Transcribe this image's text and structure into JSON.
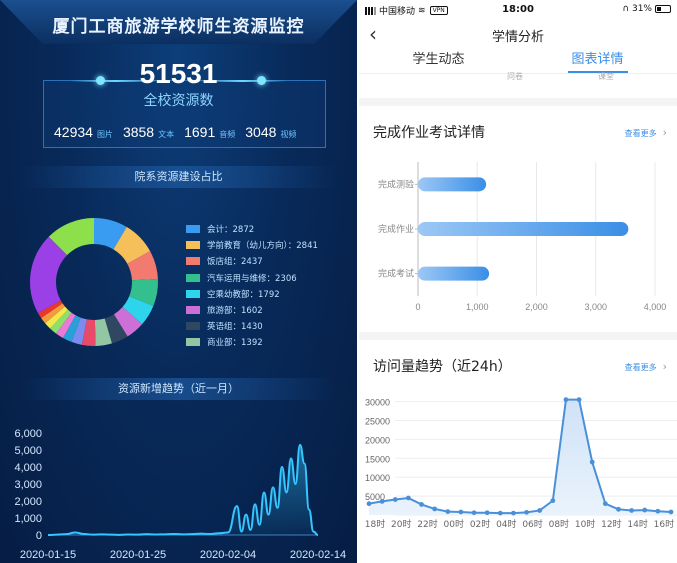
{
  "dashboard": {
    "title": "厦门工商旅游学校师生资源监控",
    "total": "51531",
    "total_label": "全校资源数",
    "stats": [
      {
        "value": "42934",
        "unit": "图片"
      },
      {
        "value": "3858",
        "unit": "文本"
      },
      {
        "value": "1691",
        "unit": "音频"
      },
      {
        "value": "3048",
        "unit": "视频"
      }
    ],
    "donut_section_title": "院系资源建设占比",
    "trend_section_title": "资源新增趋势（近一月）"
  },
  "chart_data": [
    {
      "type": "pie",
      "variant": "donut",
      "legend_position": "right",
      "legend_shows_first": 8,
      "slices": [
        {
          "label": "会计",
          "value": 2872,
          "color": "#3a9cf0"
        },
        {
          "label": "学前教育（幼儿方向）",
          "value": 2841,
          "color": "#f5c05a"
        },
        {
          "label": "饭店组",
          "value": 2437,
          "color": "#f27a6e"
        },
        {
          "label": "汽车运用与维修",
          "value": 2306,
          "color": "#34bf8f"
        },
        {
          "label": "空乘幼教部",
          "value": 1792,
          "color": "#2ed3ec"
        },
        {
          "label": "旅游部",
          "value": 1602,
          "color": "#cc6fd6"
        },
        {
          "label": "英语组",
          "value": 1430,
          "color": "#2f4760"
        },
        {
          "label": "商业部",
          "value": 1392,
          "color": "#93c7a4"
        },
        {
          "label": "",
          "value": 1150,
          "color": "#e84a6a"
        },
        {
          "label": "",
          "value": 900,
          "color": "#7a8cf0"
        },
        {
          "label": "",
          "value": 780,
          "color": "#28a0d8"
        },
        {
          "label": "",
          "value": 700,
          "color": "#e87ad8"
        },
        {
          "label": "",
          "value": 650,
          "color": "#8ee06a"
        },
        {
          "label": "",
          "value": 600,
          "color": "#f2e84c"
        },
        {
          "label": "",
          "value": 550,
          "color": "#f59b3a"
        },
        {
          "label": "",
          "value": 500,
          "color": "#e8382e"
        },
        {
          "label": "",
          "value": 6900,
          "color": "#9b3fe6"
        },
        {
          "label": "",
          "value": 4200,
          "color": "#8edf4c"
        }
      ]
    },
    {
      "type": "line",
      "area": true,
      "color": "#36c6ff",
      "x_tick_labels": [
        "2020-01-15",
        "2020-01-25",
        "2020-02-04",
        "2020-02-14"
      ],
      "y_ticks": [
        "0",
        "1,000",
        "2,000",
        "3,000",
        "4,000",
        "5,000",
        "6,000"
      ],
      "ylim": [
        0,
        6000
      ],
      "x_days": [
        0,
        1,
        2,
        3,
        4,
        5,
        6,
        7,
        8,
        9,
        10,
        11,
        12,
        13,
        14,
        15,
        16,
        17,
        18,
        19,
        20,
        21,
        21.5,
        22,
        22.5,
        23,
        23.5,
        24,
        24.5,
        25,
        25.5,
        26,
        26.5,
        27,
        27.5,
        28,
        28.5,
        29,
        29.5,
        30
      ],
      "values": [
        0,
        20,
        50,
        150,
        60,
        20,
        40,
        20,
        10,
        30,
        20,
        50,
        30,
        40,
        60,
        40,
        50,
        80,
        60,
        100,
        150,
        1700,
        200,
        1200,
        300,
        1800,
        600,
        2500,
        1200,
        2800,
        1600,
        4000,
        2500,
        4500,
        3000,
        5300,
        4200,
        1500,
        200,
        0
      ]
    },
    {
      "type": "bar",
      "orientation": "horizontal",
      "title": "完成作业考试详情",
      "categories": [
        "完成测验",
        "完成作业",
        "完成考试"
      ],
      "values": [
        1150,
        3550,
        1200
      ],
      "xlim": [
        0,
        4000
      ],
      "x_ticks": [
        "0",
        "1,000",
        "2,000",
        "3,000",
        "4,000"
      ],
      "color_from": "#9cc8f5",
      "color_to": "#3a8ee6"
    },
    {
      "type": "area",
      "title": "访问量趋势（近24h）",
      "x": [
        "18时",
        "19时",
        "20时",
        "21时",
        "22时",
        "23时",
        "00时",
        "01时",
        "02时",
        "03时",
        "04时",
        "05时",
        "06时",
        "07时",
        "08时",
        "09时",
        "10时",
        "11时",
        "12时",
        "13时",
        "14时",
        "15时",
        "16时",
        "17时"
      ],
      "x_tick_labels": [
        "18时",
        "20时",
        "22时",
        "00时",
        "02时",
        "04时",
        "06时",
        "08时",
        "10时",
        "12时",
        "14时",
        "16时"
      ],
      "values": [
        3000,
        3600,
        4100,
        4500,
        2800,
        1600,
        900,
        800,
        600,
        600,
        500,
        500,
        700,
        1200,
        3800,
        30500,
        30500,
        14000,
        3000,
        1500,
        1200,
        1300,
        1000,
        800
      ],
      "y_ticks": [
        "0",
        "5000",
        "10000",
        "15000",
        "20000",
        "25000",
        "30000"
      ],
      "ylim": [
        0,
        32000
      ],
      "color": "#4a90d9"
    }
  ],
  "phone": {
    "status": {
      "carrier": "中国移动",
      "vpn": "VPN",
      "time": "18:00",
      "battery": "31%"
    },
    "nav_title": "学情分析",
    "tabs": [
      "学生动态",
      "图表详情"
    ],
    "active_tab": 1,
    "peek_labels": [
      "问卷",
      "课堂"
    ],
    "card1": {
      "title": "完成作业考试详情",
      "more": "查看更多"
    },
    "card2": {
      "title": "访问量趋势（近24h）",
      "more": "查看更多"
    }
  }
}
